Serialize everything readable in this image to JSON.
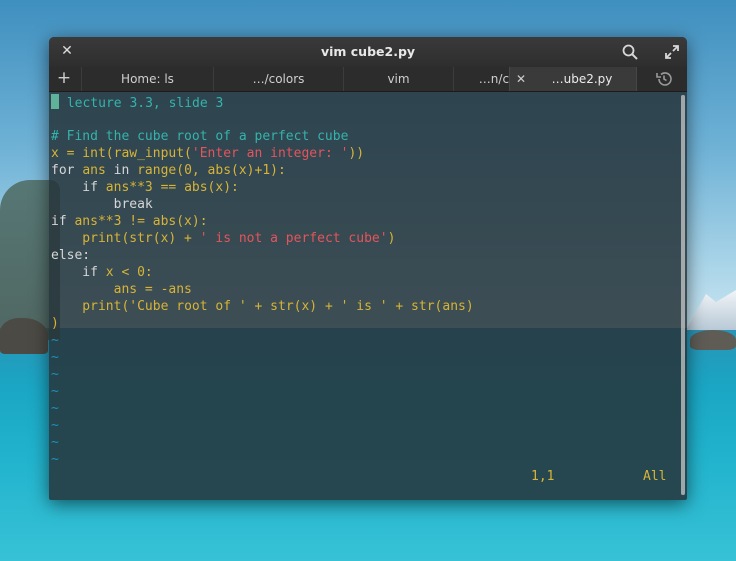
{
  "window": {
    "title": "vim cube2.py"
  },
  "tabs": [
    {
      "label": "Home: ls",
      "active": false
    },
    {
      "label": "…/colors",
      "active": false
    },
    {
      "label": "vim",
      "active": false
    },
    {
      "label": "…n/cc.py",
      "active": false
    },
    {
      "label": "…ube2.py",
      "active": true
    }
  ],
  "icons": {
    "close": "close-icon",
    "search": "search-icon",
    "fullscreen": "fullscreen-icon",
    "new_tab": "plus-icon",
    "history": "history-icon"
  },
  "colors": {
    "comment": "#35b3ad",
    "keyword": "#d7b437",
    "string": "#e4545c",
    "text": "#d6d6d6",
    "tilde": "#1f8fb8"
  },
  "code": {
    "l1": " lecture 3.3, slide 3",
    "l2": "",
    "l3": "# Find the cube root of a perfect cube",
    "l4_a": "x = int(raw_input(",
    "l4_b": "'Enter an integer: '",
    "l4_c": "))",
    "l5_a": "for ",
    "l5_b": "ans",
    "l5_c": " in ",
    "l5_d": "range(0, abs(x)+1):",
    "l6_a": "    if ",
    "l6_b": "ans**3 == abs(x):",
    "l7": "        break",
    "l8_a": "if ",
    "l8_b": "ans**3 != abs(x):",
    "l9_a": "    print(str(x) + ",
    "l9_b": "' is not a perfect cube'",
    "l9_c": ")",
    "l10": "else:",
    "l11_a": "    if ",
    "l11_b": "x < 0:",
    "l12": "        ans = -ans",
    "l13_a": "    print(",
    "l13_b": "'Cube root of '",
    "l13_c": " + str(x) + ",
    "l13_d": "' is '",
    "l13_e": " + str(ans)",
    "l14": ")",
    "tilde": "~"
  },
  "status": {
    "position": "1,1",
    "scroll": "All"
  }
}
